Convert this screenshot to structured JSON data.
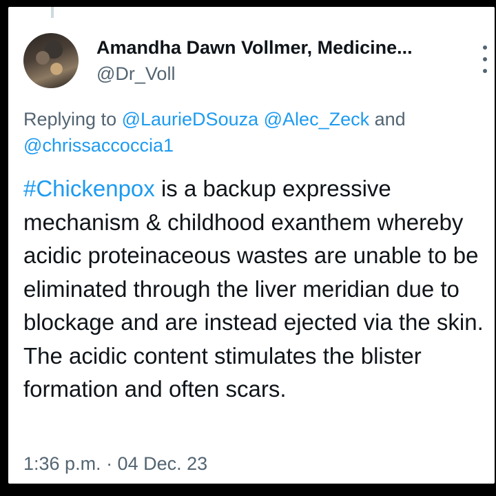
{
  "tweet": {
    "author": {
      "display_name": "Amandha Dawn Vollmer, Medicine...",
      "handle": "@Dr_Voll"
    },
    "replying": {
      "prefix": "Replying to ",
      "mentions": [
        "@LaurieDSouza",
        "@Alec_Zeck"
      ],
      "conjunction": " and",
      "last_mention": "@chrissaccoccia1"
    },
    "hashtag": "#Chickenpox",
    "body": " is a backup expressive mechanism & childhood exanthem whereby acidic proteinaceous wastes are unable to be eliminated through the liver meridian due to blockage and are instead ejected via the skin. The acidic content stimulates the blister formation and often scars.",
    "timestamp": "1:36 p.m. · 04 Dec. 23"
  },
  "icons": {
    "more": "more-vertical-icon",
    "avatar": "avatar"
  },
  "colors": {
    "link": "#1d9bf0",
    "text": "#0f1419",
    "secondary": "#536471",
    "frame": "#000000"
  }
}
